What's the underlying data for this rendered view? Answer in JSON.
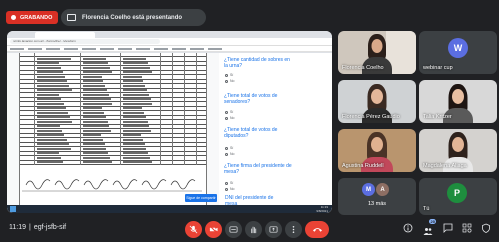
{
  "recording": {
    "label": "GRABANDO",
    "color": "#d93025"
  },
  "presenter": {
    "text": "Florencia Coelho está presentando"
  },
  "browser": {
    "url": "ncinfo.lanacion.com.ar/.../forms/d/e/.../viewform"
  },
  "form": {
    "questions": [
      {
        "text": "¿Tiene cantidad de sobres en la urna?",
        "options": [
          "Sí",
          "No"
        ]
      },
      {
        "text": "¿Tiene total de votos de senadores?",
        "options": [
          "Sí",
          "No"
        ]
      },
      {
        "text": "¿Tiene total de votos de diputados?",
        "options": [
          "Sí",
          "No"
        ]
      },
      {
        "text": "¿Tiene firma del presidente de mesa?",
        "options": [
          "Sí",
          "No"
        ]
      }
    ],
    "dni_label": "DNI del presidente de mesa",
    "tooltip": "Sigue de compartir"
  },
  "taskbar": {
    "time": "11:19",
    "date": "9/8/2021"
  },
  "participants": [
    {
      "name": "Florencia Coelho",
      "type": "video"
    },
    {
      "name": "webinar cup",
      "type": "avatar",
      "initial": "W",
      "color": "#5b6ee1"
    },
    {
      "name": "Florencia Pérez Gaudio",
      "type": "video"
    },
    {
      "name": "Talia Kritzer",
      "type": "video"
    },
    {
      "name": "Agustina Ruddell",
      "type": "video"
    },
    {
      "name": "Magdalena Aliaga",
      "type": "video"
    },
    {
      "name": "13 más",
      "type": "group",
      "initials": [
        "M",
        "A"
      ]
    },
    {
      "name": "Tú",
      "type": "avatar",
      "initial": "P",
      "color": "#1e8e3e"
    }
  ],
  "meeting": {
    "time": "11:19",
    "code": "egf-jsfb-sif"
  },
  "controls": [
    "mic-off",
    "camera-off",
    "captions",
    "raise-hand",
    "present",
    "more",
    "end-call"
  ],
  "right_controls": {
    "info": "info",
    "people_count": "20",
    "chat": "chat",
    "activities": "activities",
    "host": "host-controls"
  }
}
